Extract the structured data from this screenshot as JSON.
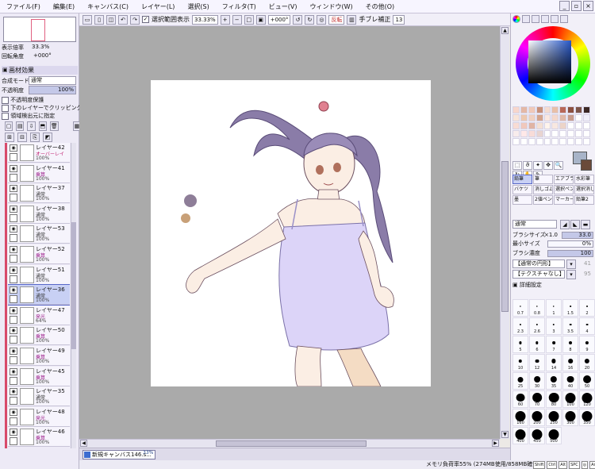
{
  "menu": [
    "ファイル(F)",
    "編集(E)",
    "キャンバス(C)",
    "レイヤー(L)",
    "選択(S)",
    "フィルタ(T)",
    "ビュー(V)",
    "ウィンドウ(W)",
    "その他(O)"
  ],
  "toolbar": {
    "show_selection_label": "選択範囲表示",
    "zoom": "33.33%",
    "rotate": "+000°",
    "flip_label": "反転",
    "stabilizer_label": "手ブレ補正",
    "stabilizer_value": "13"
  },
  "navigator": {
    "zoom_label": "表示倍率",
    "zoom_value": "33.3%",
    "rotate_label": "回転角度",
    "rotate_value": "+000°"
  },
  "layer_effects": {
    "title": "画材効果",
    "blend_label": "合成モード",
    "blend_value": "通常",
    "opacity_label": "不透明度",
    "opacity_value": "100%",
    "opts": [
      "不透明度保護",
      "下のレイヤーでクリッピング",
      "領域検出元に指定"
    ]
  },
  "layers": [
    {
      "name": "レイヤー42",
      "mode": "オーバーレイ",
      "cls": "mode-ov",
      "opacity": "100%"
    },
    {
      "name": "レイヤー41",
      "mode": "乗算",
      "cls": "mode-mul",
      "opacity": "100%"
    },
    {
      "name": "レイヤー37",
      "mode": "通常",
      "cls": "mode-normal",
      "opacity": "100%"
    },
    {
      "name": "レイヤー38",
      "mode": "通常",
      "cls": "mode-normal",
      "opacity": "100%"
    },
    {
      "name": "レイヤー53",
      "mode": "通常",
      "cls": "mode-normal",
      "opacity": "100%"
    },
    {
      "name": "レイヤー52",
      "mode": "乗算",
      "cls": "mode-mul",
      "opacity": "100%"
    },
    {
      "name": "レイヤー51",
      "mode": "通常",
      "cls": "mode-normal",
      "opacity": "100%"
    },
    {
      "name": "レイヤー36",
      "mode": "通常",
      "cls": "mode-normal",
      "opacity": "100%",
      "selected": true
    },
    {
      "name": "レイヤー47",
      "mode": "発光",
      "cls": "mode-mul",
      "opacity": "64%"
    },
    {
      "name": "レイヤー50",
      "mode": "乗算",
      "cls": "mode-mul",
      "opacity": "100%"
    },
    {
      "name": "レイヤー49",
      "mode": "乗算",
      "cls": "mode-mul",
      "opacity": "100%"
    },
    {
      "name": "レイヤー45",
      "mode": "乗算",
      "cls": "mode-mul",
      "opacity": "100%"
    },
    {
      "name": "レイヤー35",
      "mode": "通常",
      "cls": "mode-normal",
      "opacity": "100%"
    },
    {
      "name": "レイヤー48",
      "mode": "発光",
      "cls": "mode-mul",
      "opacity": "100%"
    },
    {
      "name": "レイヤー46",
      "mode": "乗算",
      "cls": "mode-mul",
      "opacity": "100%"
    }
  ],
  "document": {
    "tab_name": "新規キャンバス146.s...",
    "tab_zoom": "33%"
  },
  "status": {
    "memory": "メモリ負荷率55% (274MB使用/858MB確保)",
    "keys": [
      "Shift",
      "Ctrl",
      "Alt",
      "SPC",
      "◎",
      "Any"
    ]
  },
  "colors": {
    "swatches": [
      "#f7d6cc",
      "#e4b8a6",
      "#f0c8b8",
      "#c89078",
      "#f4dcd0",
      "#e8c0a8",
      "#b86858",
      "#8c5040",
      "#7c5448",
      "#3c2824",
      "#f8e4d8",
      "#ecc8b0",
      "#f0d0c0",
      "#d4a48c",
      "#fae8e0",
      "#f4d8cc",
      "#e0b8a8",
      "#c89c8c",
      "#ffffff",
      "#f0eef8",
      "#f8dcd4",
      "#f0c8bc",
      "#e0b4a4",
      "#f4e0d4",
      "#fff4ec",
      "#f8e8e0",
      "#ecd4c8",
      "#ffffff",
      "#ffffff",
      "#ffffff",
      "#f8ecec",
      "#ffe8e8",
      "#f8dcd8",
      "#e8d4d0",
      "#ffffff",
      "#ffffff",
      "#ffffff",
      "#ffffff",
      "#ffffff",
      "#ffffff",
      "#ffffff",
      "#ffffff",
      "#ffffff",
      "#ffffff",
      "#ffffff",
      "#ffffff",
      "#ffffff",
      "#ffffff",
      "#ffffff",
      "#ffffff"
    ]
  },
  "tools": [
    "鉛筆",
    "筆",
    "エアブラシ",
    "水彩筆",
    "バケツ",
    "消しゴム",
    "選択ペン",
    "選択消し",
    "墨",
    "2値ペン",
    "マーカー",
    "鉛筆2"
  ],
  "brush": {
    "blend": "通常",
    "size_label": "ブラシサイズ",
    "size_mult": "×1.0",
    "size_value": "33.0",
    "min_label": "最小サイズ",
    "min_value": "0%",
    "density_label": "ブラシ濃度",
    "density_value": "100",
    "shape1": "【通常の円形】",
    "shape1_val": "41",
    "texture": "【テクスチャなし】",
    "texture_val": "95",
    "detail_label": "詳細設定"
  },
  "sizes": [
    "0.7",
    "0.8",
    "1",
    "1.5",
    "2",
    "2.3",
    "2.6",
    "3",
    "3.5",
    "4",
    "5",
    "6",
    "7",
    "8",
    "9",
    "10",
    "12",
    "14",
    "16",
    "20",
    "25",
    "30",
    "35",
    "40",
    "50",
    "60",
    "70",
    "80",
    "100",
    "120",
    "160",
    "200",
    "250",
    "300",
    "350",
    "400",
    "450",
    "500"
  ]
}
